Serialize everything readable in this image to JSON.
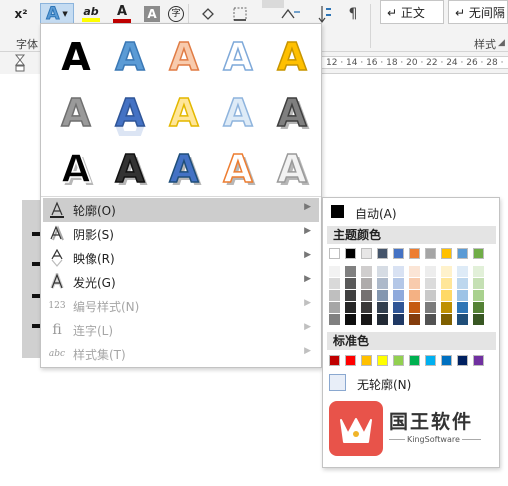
{
  "ribbon": {
    "superscript_label": "x²",
    "text_effects_glyph": "A",
    "highlight_glyph": "ab",
    "font_color_glyph": "A",
    "char_shading_glyph": "A",
    "enclose_char_glyph": "字",
    "font_group_label": "字体",
    "styles_group_label": "样式",
    "style_normal": "↵ 正文",
    "style_no_spacing": "↵ 无间隔",
    "highlight_color": "#ffff00",
    "font_color": "#c00000"
  },
  "ruler": {
    "ticks": "12 · 14 · 16 · 18 · 20 · 22 · 24 · 26 · 28 ·"
  },
  "effects_menu": {
    "gallery_glyph": "A",
    "items": [
      {
        "label": "轮廓(O)",
        "icon": "outline-pen-icon",
        "disabled": false
      },
      {
        "label": "阴影(S)",
        "icon": "shadow-icon",
        "disabled": false
      },
      {
        "label": "映像(R)",
        "icon": "reflection-icon",
        "disabled": false
      },
      {
        "label": "发光(G)",
        "icon": "glow-icon",
        "disabled": false
      },
      {
        "label": "编号样式(N)",
        "icon": "number-style-icon",
        "disabled": true
      },
      {
        "label": "连字(L)",
        "icon": "ligature-icon",
        "disabled": true
      },
      {
        "label": "样式集(T)",
        "icon": "stylistic-set-icon",
        "disabled": true
      }
    ],
    "icon_text": {
      "number": "123",
      "ligature": "fi",
      "stylistic": "abc"
    }
  },
  "outline_submenu": {
    "auto_label": "自动(A)",
    "theme_colors_label": "主题颜色",
    "standard_colors_label": "标准色",
    "no_outline_label": "无轮廓(N)",
    "theme_colors": [
      "#ffffff",
      "#000000",
      "#e7e6e6",
      "#44546a",
      "#4472c4",
      "#ed7d31",
      "#a5a5a5",
      "#ffc000",
      "#5b9bd5",
      "#70ad47"
    ],
    "theme_shades": [
      [
        "#f2f2f2",
        "#d9d9d9",
        "#bfbfbf",
        "#a6a6a6",
        "#808080"
      ],
      [
        "#808080",
        "#595959",
        "#404040",
        "#262626",
        "#0d0d0d"
      ],
      [
        "#d0cece",
        "#aeabab",
        "#757171",
        "#3a3838",
        "#171616"
      ],
      [
        "#d6dce4",
        "#adb9ca",
        "#8497b0",
        "#333f4f",
        "#222a35"
      ],
      [
        "#d9e2f3",
        "#b4c7e7",
        "#8faadc",
        "#2f5597",
        "#1f3864"
      ],
      [
        "#fbe5d6",
        "#f8cbad",
        "#f4b183",
        "#c55a11",
        "#843c0c"
      ],
      [
        "#ededed",
        "#dbdbdb",
        "#c9c9c9",
        "#7b7b7b",
        "#525252"
      ],
      [
        "#fff2cc",
        "#ffe699",
        "#ffd966",
        "#bf9000",
        "#7f6000"
      ],
      [
        "#deebf7",
        "#bdd7ee",
        "#9dc3e6",
        "#2e75b6",
        "#1f4e79"
      ],
      [
        "#e2f0d9",
        "#c5e0b4",
        "#a9d18e",
        "#548235",
        "#385723"
      ]
    ],
    "standard_colors": [
      "#c00000",
      "#ff0000",
      "#ffc000",
      "#ffff00",
      "#92d050",
      "#00b050",
      "#00b0f0",
      "#0070c0",
      "#002060",
      "#7030a0"
    ]
  },
  "watermark": {
    "name": "国王软件",
    "sub": "KingSoftware",
    "logo_color": "#e8534a"
  }
}
